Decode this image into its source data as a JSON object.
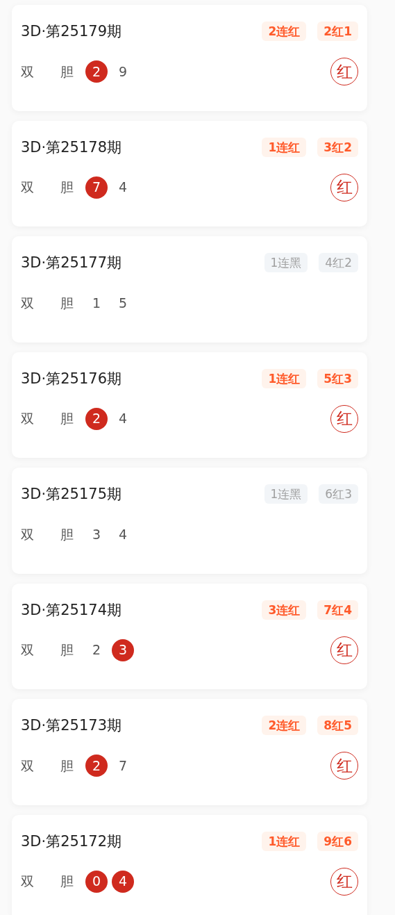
{
  "draws": [
    {
      "title": "3D·第25179期",
      "badges": [
        {
          "text": "2连红",
          "kind": "red"
        },
        {
          "text": "2红1",
          "kind": "red"
        }
      ],
      "label_1": "双",
      "label_2": "胆",
      "numbers": [
        {
          "value": "2",
          "hit": true
        },
        {
          "value": "9",
          "hit": false
        }
      ],
      "result": "红"
    },
    {
      "title": "3D·第25178期",
      "badges": [
        {
          "text": "1连红",
          "kind": "red"
        },
        {
          "text": "3红2",
          "kind": "red"
        }
      ],
      "label_1": "双",
      "label_2": "胆",
      "numbers": [
        {
          "value": "7",
          "hit": true
        },
        {
          "value": "4",
          "hit": false
        }
      ],
      "result": "红"
    },
    {
      "title": "3D·第25177期",
      "badges": [
        {
          "text": "1连黑",
          "kind": "black"
        },
        {
          "text": "4红2",
          "kind": "black"
        }
      ],
      "label_1": "双",
      "label_2": "胆",
      "numbers": [
        {
          "value": "1",
          "hit": false
        },
        {
          "value": "5",
          "hit": false
        }
      ]
    },
    {
      "title": "3D·第25176期",
      "badges": [
        {
          "text": "1连红",
          "kind": "red"
        },
        {
          "text": "5红3",
          "kind": "red"
        }
      ],
      "label_1": "双",
      "label_2": "胆",
      "numbers": [
        {
          "value": "2",
          "hit": true
        },
        {
          "value": "4",
          "hit": false
        }
      ],
      "result": "红"
    },
    {
      "title": "3D·第25175期",
      "badges": [
        {
          "text": "1连黑",
          "kind": "black"
        },
        {
          "text": "6红3",
          "kind": "black"
        }
      ],
      "label_1": "双",
      "label_2": "胆",
      "numbers": [
        {
          "value": "3",
          "hit": false
        },
        {
          "value": "4",
          "hit": false
        }
      ]
    },
    {
      "title": "3D·第25174期",
      "badges": [
        {
          "text": "3连红",
          "kind": "red"
        },
        {
          "text": "7红4",
          "kind": "red"
        }
      ],
      "label_1": "双",
      "label_2": "胆",
      "numbers": [
        {
          "value": "2",
          "hit": false
        },
        {
          "value": "3",
          "hit": true
        }
      ],
      "result": "红"
    },
    {
      "title": "3D·第25173期",
      "badges": [
        {
          "text": "2连红",
          "kind": "red"
        },
        {
          "text": "8红5",
          "kind": "red"
        }
      ],
      "label_1": "双",
      "label_2": "胆",
      "numbers": [
        {
          "value": "2",
          "hit": true
        },
        {
          "value": "7",
          "hit": false
        }
      ],
      "result": "红"
    },
    {
      "title": "3D·第25172期",
      "badges": [
        {
          "text": "1连红",
          "kind": "red"
        },
        {
          "text": "9红6",
          "kind": "red"
        }
      ],
      "label_1": "双",
      "label_2": "胆",
      "numbers": [
        {
          "value": "0",
          "hit": true
        },
        {
          "value": "4",
          "hit": true
        }
      ],
      "result": "红"
    }
  ]
}
